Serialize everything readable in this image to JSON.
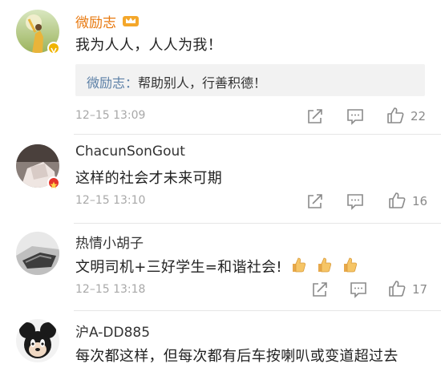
{
  "comments": [
    {
      "username": "微励志",
      "text": "我为人人，人人为我！",
      "reply": {
        "user": "微励志：",
        "text": "帮助别人，行善积德！"
      },
      "time": "12–15 13:09",
      "likes": "22"
    },
    {
      "username": "ChacunSonGout",
      "text": "这样的社会才未来可期",
      "time": "12–15 13:10",
      "likes": "16"
    },
    {
      "username": "热情小胡子",
      "text": "文明司机+三好学生=和谐社会!",
      "time": "12–15 13:18",
      "likes": "17"
    },
    {
      "username": "沪A-DD885",
      "text": "每次都这样，但每次都有后车按喇叭或变道超过去"
    }
  ],
  "colors": {
    "vip_name": "#e8790f",
    "reply_user": "#5b7fa6",
    "meta": "#a8a8a8"
  },
  "icons": [
    "crown-icon",
    "verified-badge-icon",
    "share-icon",
    "comment-icon",
    "like-icon",
    "thumbs-up-emoji-icon"
  ]
}
